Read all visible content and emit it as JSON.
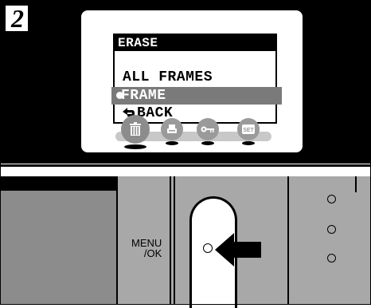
{
  "step": {
    "number": "2"
  },
  "menu": {
    "title": "ERASE",
    "items": [
      {
        "label": "ALL FRAMES",
        "selected": false
      },
      {
        "label": "FRAME",
        "selected": true
      },
      {
        "label": "BACK",
        "selected": false
      }
    ]
  },
  "icons": [
    {
      "name": "trash-icon",
      "selected": true
    },
    {
      "name": "print-icon",
      "selected": false
    },
    {
      "name": "protect-key-icon",
      "selected": false
    },
    {
      "name": "set-icon",
      "selected": false,
      "label": "SET"
    }
  ],
  "camera": {
    "button_label_line1": "MENU",
    "button_label_line2": "/OK"
  }
}
